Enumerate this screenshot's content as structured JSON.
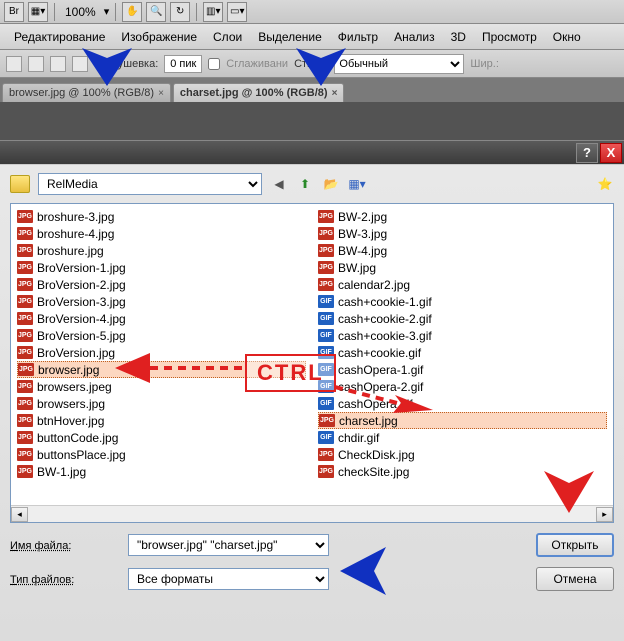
{
  "top": {
    "bridge": "Br",
    "zoom": "100%"
  },
  "menu": [
    "Редактирование",
    "Изображение",
    "Слои",
    "Выделение",
    "Фильтр",
    "Анализ",
    "3D",
    "Просмотр",
    "Окно"
  ],
  "options": {
    "feather_label": "Растушевка:",
    "feather_value": "0 пик",
    "antialias": "Сглаживани",
    "style_label": "Стиль:",
    "style_value": "Обычный",
    "width_label": "Шир.:"
  },
  "tabs": [
    {
      "label": "browser.jpg @ 100% (RGB/8)",
      "active": false
    },
    {
      "label": "charset.jpg @ 100% (RGB/8)",
      "active": true
    }
  ],
  "dialog": {
    "folder": "RelMedia",
    "files_left": [
      {
        "n": "broshure-3.jpg",
        "t": "jpg"
      },
      {
        "n": "broshure-4.jpg",
        "t": "jpg"
      },
      {
        "n": "broshure.jpg",
        "t": "jpg"
      },
      {
        "n": "BroVersion-1.jpg",
        "t": "jpg"
      },
      {
        "n": "BroVersion-2.jpg",
        "t": "jpg"
      },
      {
        "n": "BroVersion-3.jpg",
        "t": "jpg"
      },
      {
        "n": "BroVersion-4.jpg",
        "t": "jpg"
      },
      {
        "n": "BroVersion-5.jpg",
        "t": "jpg"
      },
      {
        "n": "BroVersion.jpg",
        "t": "jpg"
      },
      {
        "n": "browser.jpg",
        "t": "jpg",
        "sel": true
      },
      {
        "n": "browsers.jpeg",
        "t": "jpg"
      },
      {
        "n": "browsers.jpg",
        "t": "jpg"
      },
      {
        "n": "btnHover.jpg",
        "t": "jpg"
      },
      {
        "n": "buttonCode.jpg",
        "t": "jpg"
      },
      {
        "n": "buttonsPlace.jpg",
        "t": "jpg"
      },
      {
        "n": "BW-1.jpg",
        "t": "jpg"
      }
    ],
    "files_right": [
      {
        "n": "BW-2.jpg",
        "t": "jpg"
      },
      {
        "n": "BW-3.jpg",
        "t": "jpg"
      },
      {
        "n": "BW-4.jpg",
        "t": "jpg"
      },
      {
        "n": "BW.jpg",
        "t": "jpg"
      },
      {
        "n": "calendar2.jpg",
        "t": "jpg"
      },
      {
        "n": "cash+cookie-1.gif",
        "t": "gif"
      },
      {
        "n": "cash+cookie-2.gif",
        "t": "gif"
      },
      {
        "n": "cash+cookie-3.gif",
        "t": "gif"
      },
      {
        "n": "cash+cookie.gif",
        "t": "gif"
      },
      {
        "n": "cashOpera-1.gif",
        "t": "gif"
      },
      {
        "n": "cashOpera-2.gif",
        "t": "gif"
      },
      {
        "n": "cashOpera.gif",
        "t": "gif"
      },
      {
        "n": "charset.jpg",
        "t": "jpg",
        "sel": true
      },
      {
        "n": "chdir.gif",
        "t": "gif"
      },
      {
        "n": "CheckDisk.jpg",
        "t": "jpg"
      },
      {
        "n": "checkSite.jpg",
        "t": "jpg"
      }
    ],
    "filename_label": "Имя файла:",
    "filename_value": "\"browser.jpg\" \"charset.jpg\"",
    "filetype_label": "Тип файлов:",
    "filetype_value": "Все форматы",
    "open_btn": "Открыть",
    "cancel_btn": "Отмена"
  },
  "annotation": {
    "ctrl": "CTRL"
  }
}
